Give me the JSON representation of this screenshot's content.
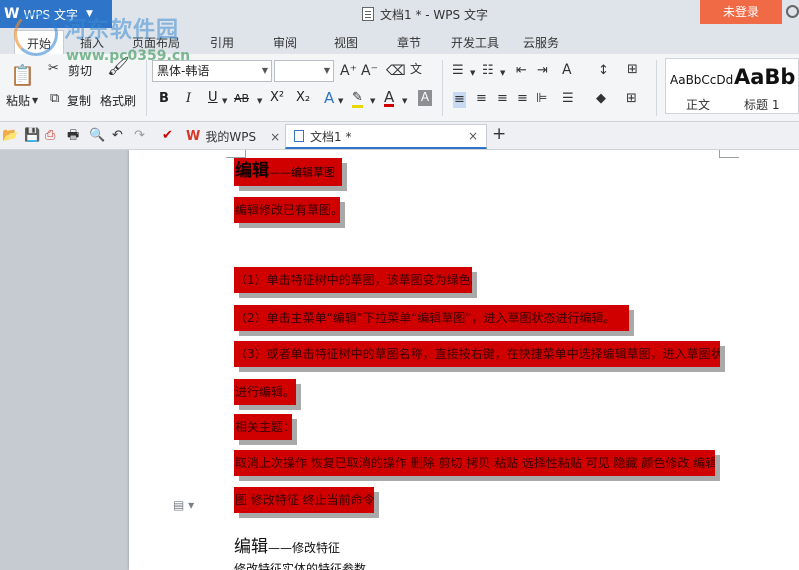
{
  "titlebar": {
    "app_name": "WPS 文字",
    "document_title": "文档1 * - WPS 文字",
    "login_label": "未登录"
  },
  "watermark": {
    "site_name": "河东软件园",
    "url": "www.pc0359.cn"
  },
  "ribbon_tabs": [
    "开始",
    "插入",
    "页面布局",
    "引用",
    "审阅",
    "视图",
    "章节",
    "开发工具",
    "云服务"
  ],
  "ribbon": {
    "paste_label": "粘贴",
    "cut_label": "剪切",
    "copy_label": "复制",
    "format_painter_label": "格式刷",
    "font_name": "黑体-韩语",
    "font_size": "",
    "bold": "B",
    "italic": "I",
    "underline": "U",
    "strikethrough": "AB",
    "superscript": "X²",
    "subscript": "X₂",
    "styles": [
      {
        "sample": "AaBbCcDd",
        "name": "正文"
      },
      {
        "sample": "AaBb",
        "name": "标题 1"
      }
    ]
  },
  "doc_tabs": [
    {
      "label": "我的WPS",
      "close": "×"
    },
    {
      "label": "文档1 *",
      "close": "×"
    }
  ],
  "new_tab": "+",
  "document": {
    "heading": {
      "main": "编辑",
      "sub": "——编辑草图"
    },
    "lines": [
      "编辑修改已有草图。",
      "（1）单击特征树中的草图，该草图变为绿色。",
      "（2）单击主菜单“编辑”下拉菜单“编辑草图”，进入草图状态进行编辑。",
      "（3）或者单击特征树中的草图名称，直接按右键，在快捷菜单中选择编辑草图，进入草图状态",
      "进行编辑。",
      "相关主题：",
      "取消上次操作  恢复已取消的操作  删除  剪切  拷贝  粘贴  选择性粘贴  可见  隐藏  颜色修改  编辑草",
      "图  修改特征  终止当前命令"
    ],
    "heading2": {
      "main": "编辑",
      "sub": "——修改特征"
    },
    "last_line": "修改特征实体的特征参数。"
  },
  "colors": {
    "highlight": "#d10000",
    "accent": "#2e74c9",
    "login": "#f06a46"
  }
}
